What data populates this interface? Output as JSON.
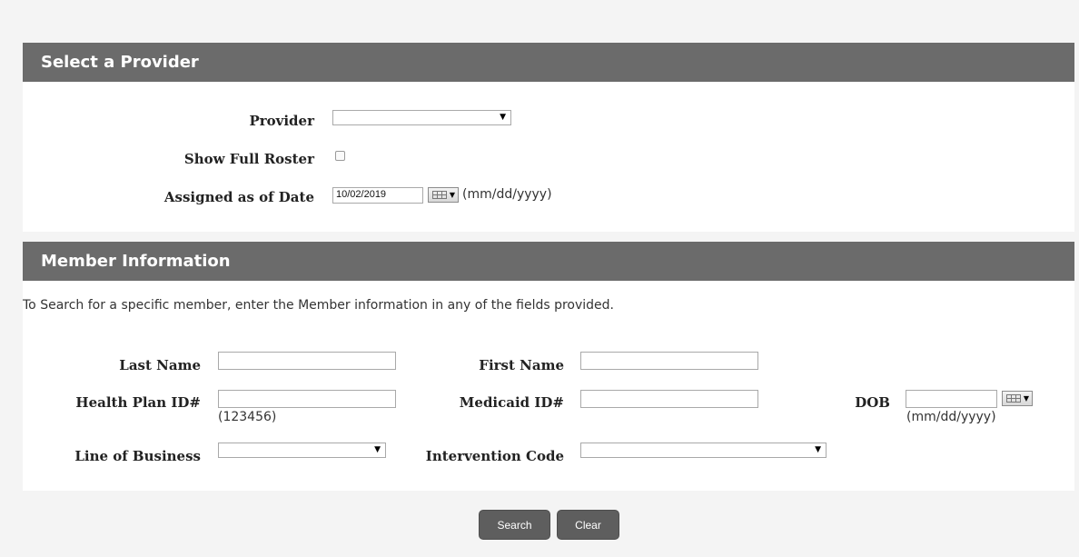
{
  "provider_section": {
    "title": "Select a Provider",
    "provider_label": "Provider",
    "provider_value": "",
    "show_full_roster_label": "Show Full Roster",
    "show_full_roster_checked": false,
    "assigned_date_label": "Assigned as of Date",
    "assigned_date_value": "10/02/2019",
    "date_format_hint": "(mm/dd/yyyy)"
  },
  "member_section": {
    "title": "Member Information",
    "instructions": "To Search for a specific member, enter the Member information in any of the fields provided.",
    "last_name_label": "Last Name",
    "last_name_value": "",
    "first_name_label": "First Name",
    "first_name_value": "",
    "health_plan_id_label": "Health Plan ID#",
    "health_plan_id_value": "",
    "health_plan_id_hint": "(123456)",
    "medicaid_id_label": "Medicaid ID#",
    "medicaid_id_value": "",
    "dob_label": "DOB",
    "dob_value": "",
    "dob_hint": "(mm/dd/yyyy)",
    "line_of_business_label": "Line of Business",
    "line_of_business_value": "",
    "intervention_code_label": "Intervention Code",
    "intervention_code_value": ""
  },
  "actions": {
    "search_label": "Search",
    "clear_label": "Clear"
  },
  "icons": {
    "dropdown": "chevron-down-icon",
    "calendar": "calendar-icon"
  }
}
